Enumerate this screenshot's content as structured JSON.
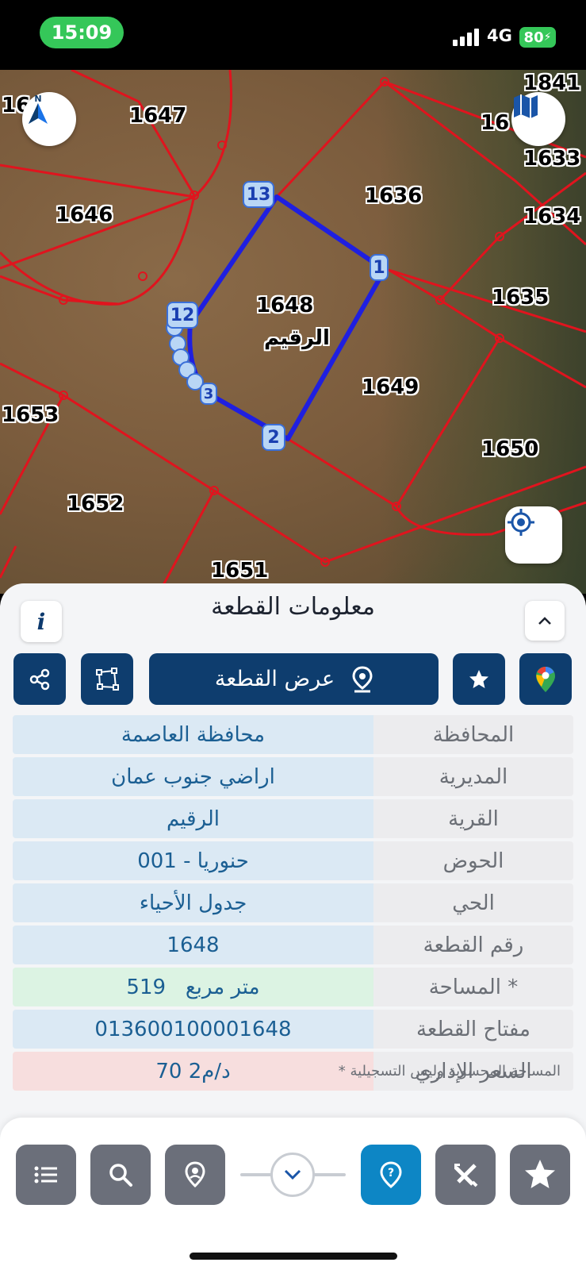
{
  "status": {
    "time": "15:09",
    "network": "4G",
    "battery": "80"
  },
  "map": {
    "plot_labels": [
      "16",
      "1647",
      "1841",
      "16",
      "1633",
      "1636",
      "1646",
      "1634",
      "1648",
      "1635",
      "1649",
      "1653",
      "1650",
      "1652",
      "1651"
    ],
    "selected_plot_number": "1648",
    "selected_plot_village": "الرقيم",
    "vertices": [
      "13",
      "1",
      "12",
      "2",
      "3"
    ],
    "colors": {
      "boundary": "#e0141e",
      "selected": "#1f1fe0",
      "vertex_fill": "#b9d6f5"
    },
    "icons": {
      "north": "compass-north-icon",
      "layers": "map-layers-icon",
      "locate": "my-location-icon"
    }
  },
  "panel": {
    "title": "معلومات القطعة",
    "info_button": "i",
    "show_plot_label": "عرض القطعة",
    "rows": [
      {
        "key": "المحافظة",
        "value": "محافظة العاصمة"
      },
      {
        "key": "المديرية",
        "value": "اراضي جنوب عمان"
      },
      {
        "key": "القرية",
        "value": "الرقيم"
      },
      {
        "key": "الحوض",
        "value": "حنوريا - 001"
      },
      {
        "key": "الحي",
        "value": "جدول الأحياء"
      },
      {
        "key": "رقم القطعة",
        "value": "1648"
      },
      {
        "key": "المساحة *",
        "value": "519   متر مربع"
      },
      {
        "key": "مفتاح القطعة",
        "value": "013600100001648"
      },
      {
        "key": "السعر الإداري",
        "value": "70 د/م2"
      }
    ],
    "footnote": "* المساحة المحسوبة وليس التسجيلية"
  },
  "bottom_bar": {
    "buttons": [
      "list-icon",
      "search-icon",
      "location-pin-icon",
      "help-icon",
      "tools-icon",
      "star-icon"
    ],
    "active": "help-icon"
  }
}
